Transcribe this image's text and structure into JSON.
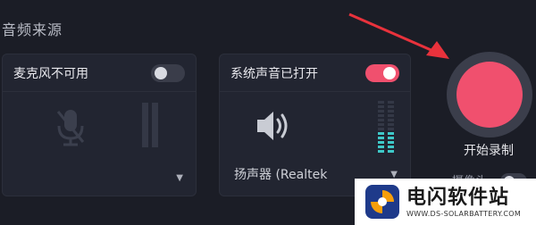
{
  "section": {
    "title": "音频来源"
  },
  "mic_card": {
    "label": "麦克风不可用",
    "toggle_on": false,
    "icon": "mic-muted-icon",
    "level": 0
  },
  "system_card": {
    "label": "系统声音已打开",
    "toggle_on": true,
    "icon": "speaker-icon",
    "device": "扬声器 (Realtek",
    "level": 0.42
  },
  "record": {
    "label": "开始录制",
    "partial_label": "摄像头"
  },
  "watermark": {
    "title": "电闪软件站",
    "url": "WWW.DS-SOLARBATTERY.COM"
  },
  "colors": {
    "accent": "#f0506e",
    "meter": "#3ec8c8",
    "arrow": "#e8323c"
  }
}
